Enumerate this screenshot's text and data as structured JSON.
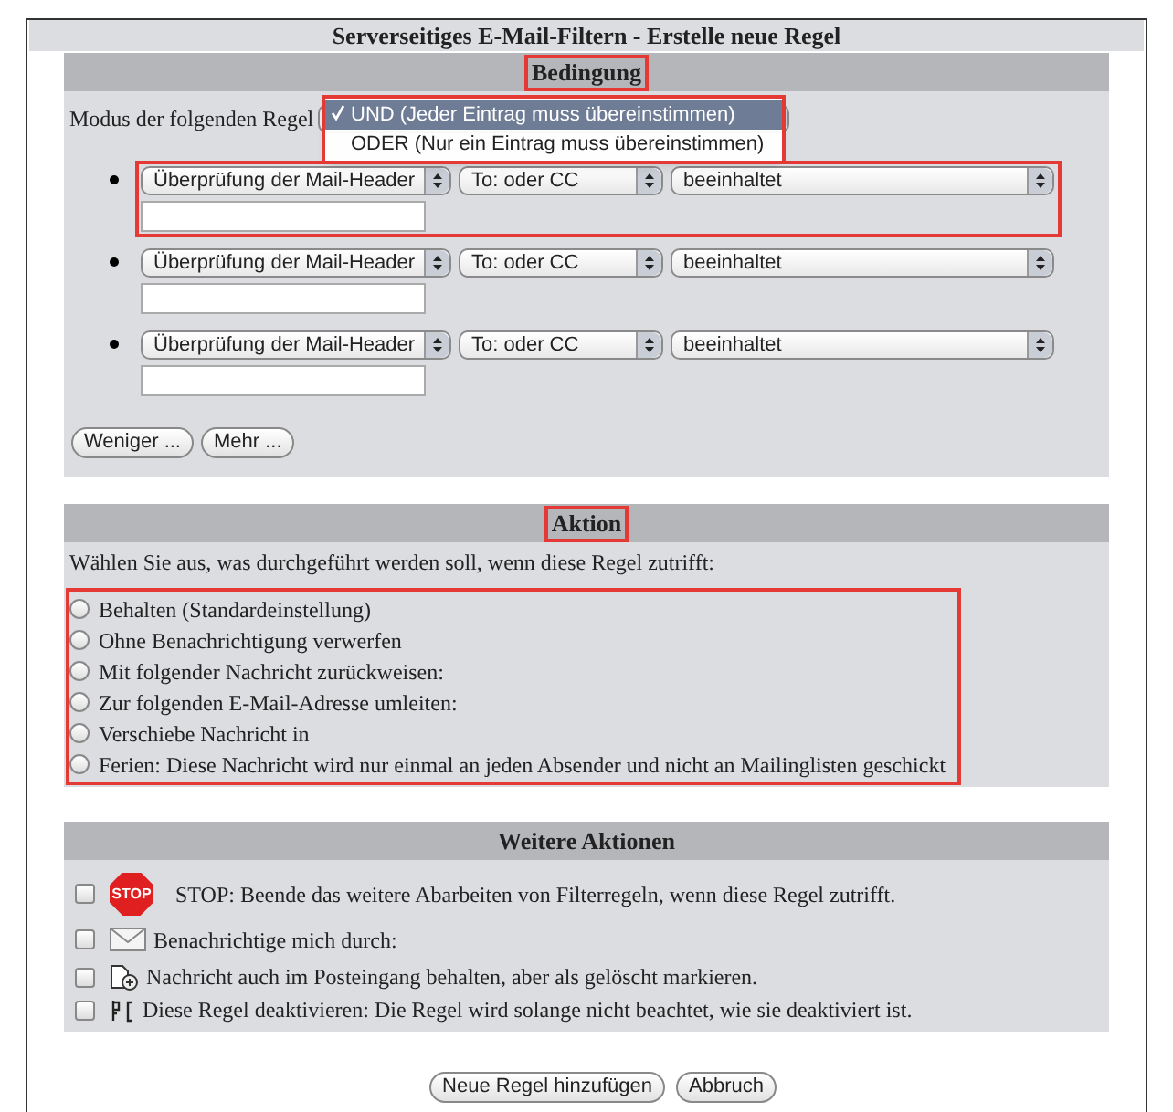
{
  "title": "Serverseitiges E-Mail-Filtern - Erstelle neue Regel",
  "condition": {
    "heading": {
      "text": "Bedingung",
      "highlighted": true
    },
    "mode_label": "Modus der folgenden Regel",
    "mode_menu_highlighted": true,
    "mode_menu": [
      {
        "label": "UND (Jeder Eintrag muss übereinstimmen)",
        "selected": true
      },
      {
        "label": "ODER (Nur ein Eintrag muss übereinstimmen)",
        "selected": false
      }
    ],
    "rules": [
      {
        "field": "Überprüfung der Mail-Header",
        "header": "To: oder CC",
        "operator": "beeinhaltet",
        "highlighted": true
      },
      {
        "field": "Überprüfung der Mail-Header",
        "header": "To: oder CC",
        "operator": "beeinhaltet",
        "highlighted": false
      },
      {
        "field": "Überprüfung der Mail-Header",
        "header": "To: oder CC",
        "operator": "beeinhaltet",
        "highlighted": false
      }
    ],
    "buttons": [
      "Weniger ...",
      "Mehr ..."
    ]
  },
  "action": {
    "heading": {
      "text": "Aktion",
      "highlighted": true
    },
    "prompt": "Wählen Sie aus, was durchgeführt werden soll, wenn diese Regel zutrifft:",
    "options_highlighted": true,
    "options": [
      {
        "label": "Behalten (Standardeinstellung)",
        "selected": false
      },
      {
        "label": "Ohne Benachrichtigung verwerfen",
        "selected": false
      },
      {
        "label": "Mit folgender Nachricht zurückweisen:",
        "selected": false
      },
      {
        "label": "Zur folgenden E-Mail-Adresse umleiten:",
        "selected": false
      },
      {
        "label": "Verschiebe Nachricht in",
        "selected": false
      },
      {
        "label": "Ferien: Diese Nachricht wird nur einmal an jeden Absender und nicht an Mailinglisten geschickt",
        "selected": false
      }
    ]
  },
  "more_actions": {
    "heading": {
      "text": "Weitere Aktionen",
      "highlighted": false
    },
    "items": [
      {
        "kind": "stop",
        "icon_text": "STOP",
        "label": "STOP: Beende das weitere Abarbeiten von Filterregeln, wenn diese Regel zutrifft.",
        "checked": false
      },
      {
        "kind": "mail",
        "label": "Benachrichtige mich durch:",
        "checked": false
      },
      {
        "kind": "copy",
        "label": "Nachricht auch im Posteingang behalten, aber als gelöscht markieren.",
        "checked": false
      },
      {
        "kind": "disable",
        "label": "Diese Regel deaktivieren: Die Regel wird solange nicht beachtet, wie sie deaktiviert ist.",
        "checked": false
      }
    ]
  },
  "buttons": [
    "Neue Regel hinzufügen",
    "Abbruch"
  ]
}
